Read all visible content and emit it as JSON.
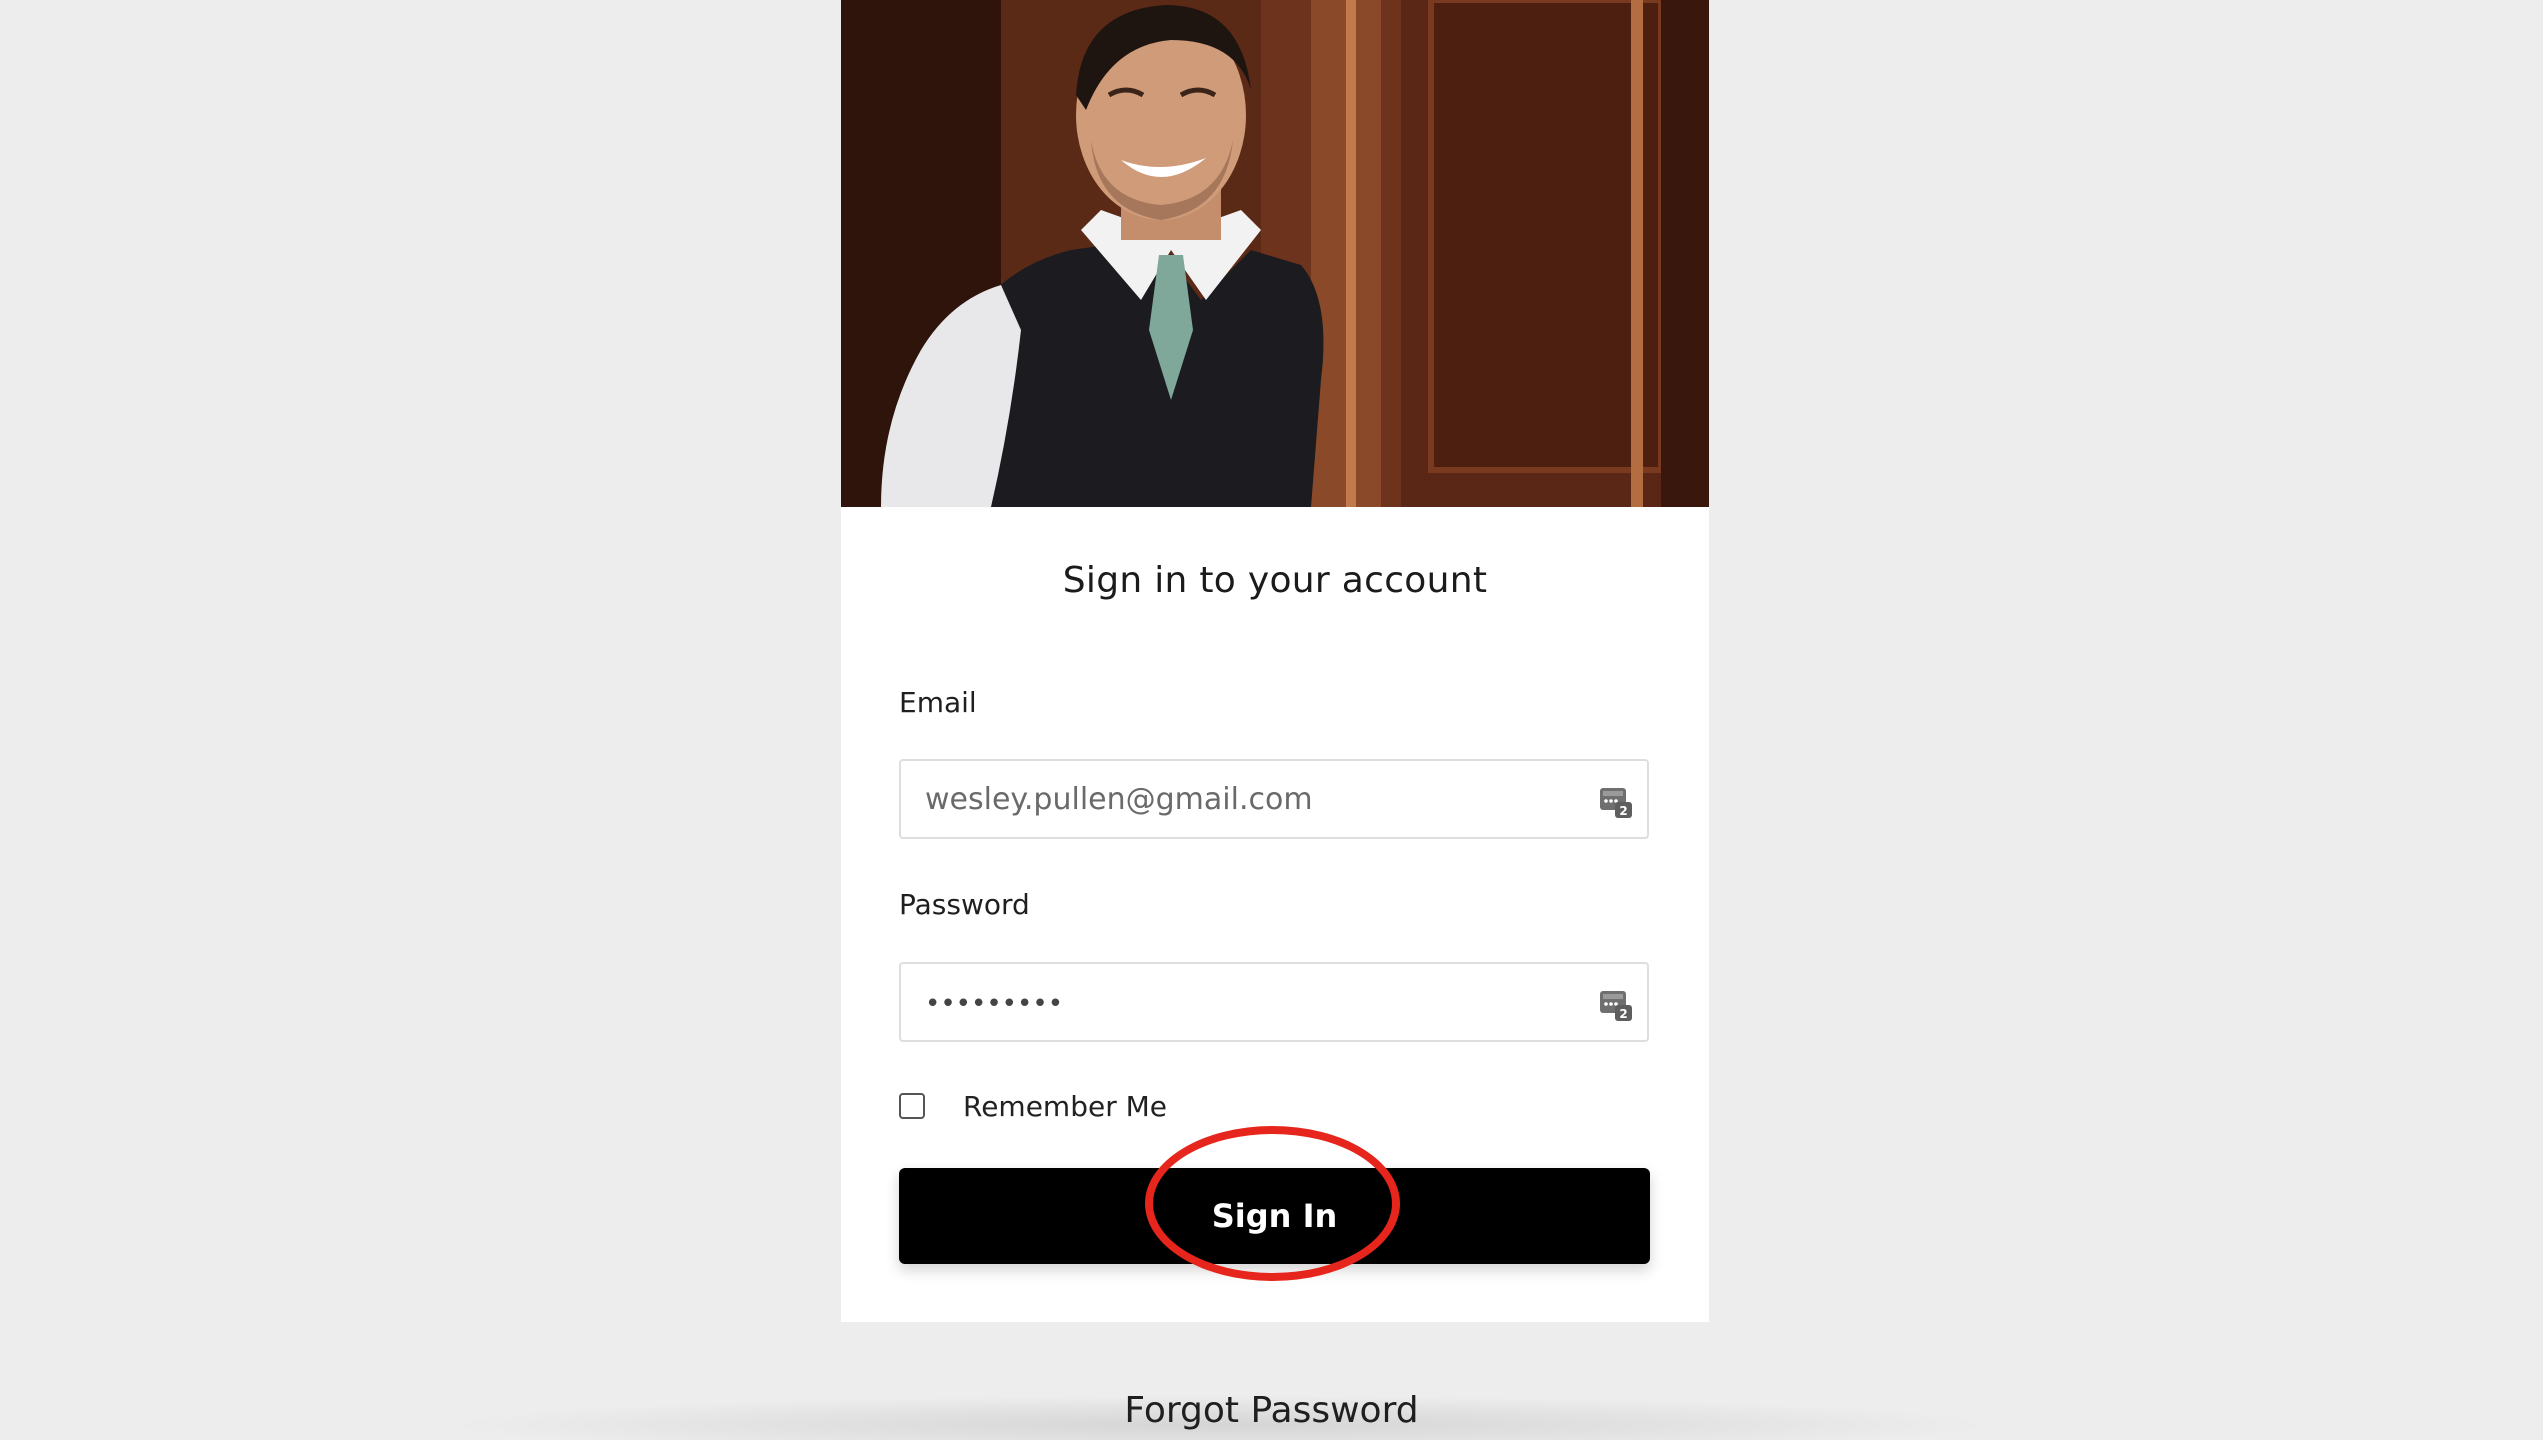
{
  "login": {
    "title": "Sign in to your account",
    "email": {
      "label": "Email",
      "value": "wesley.pullen@gmail.com"
    },
    "password": {
      "label": "Password",
      "masked_value": "•••••••••"
    },
    "remember_me": {
      "label": "Remember Me",
      "checked": false
    },
    "submit_label": "Sign In",
    "forgot_password_label": "Forgot Password"
  },
  "hero_image": {
    "description_icon": "smiling-man-in-vest-photo"
  },
  "icons": {
    "field_addon": "password-manager-icon"
  },
  "colors": {
    "page_background": "#ededed",
    "card_background": "#ffffff",
    "button_background": "#000000",
    "button_text": "#ffffff",
    "annotation_ring": "#e6261c"
  }
}
